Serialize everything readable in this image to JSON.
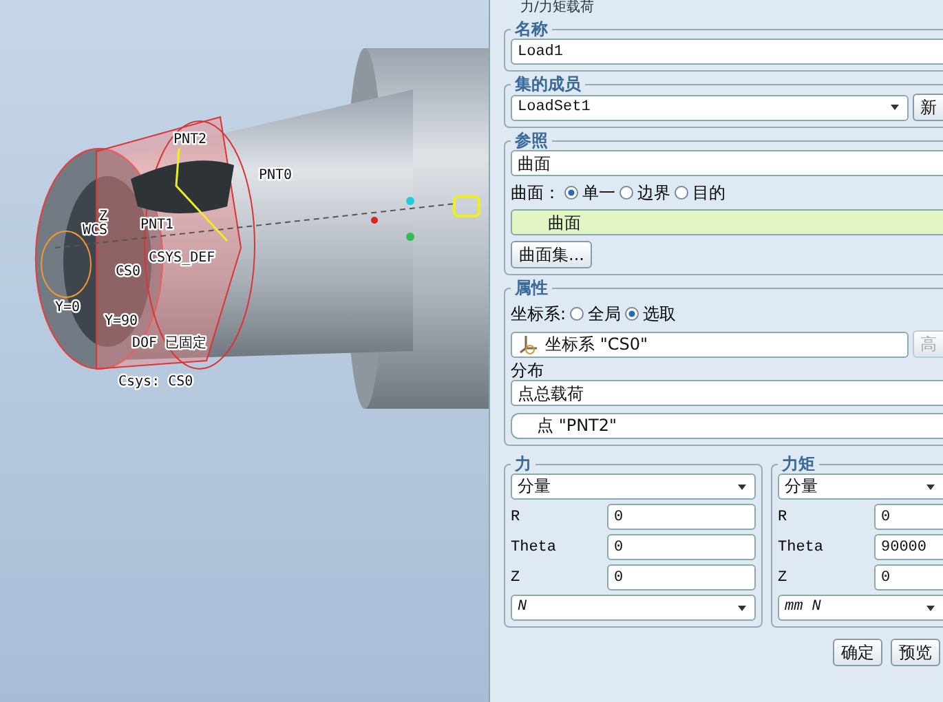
{
  "window": {
    "title": "力/力矩载荷"
  },
  "viewport": {
    "labels": [
      "PNT2",
      "PNT0",
      "PNT1",
      "Z",
      "WCS",
      "CSYS_DEF",
      "CS0",
      "Y=0",
      "Y=90",
      "DOF 已固定",
      "Csys: CS0"
    ]
  },
  "name": {
    "label": "名称",
    "value": "Load1"
  },
  "member_set": {
    "label": "集的成员",
    "value": "LoadSet1",
    "button": "新"
  },
  "references": {
    "label": "参照",
    "type_value": "曲面",
    "radio_label": "曲面：",
    "options": [
      {
        "label": "单一",
        "selected": true
      },
      {
        "label": "边界",
        "selected": false
      },
      {
        "label": "目的",
        "selected": false
      }
    ],
    "collector": "曲面",
    "button": "曲面集..."
  },
  "properties": {
    "label": "属性",
    "csys_label": "坐标系:",
    "options": [
      {
        "label": "全局",
        "selected": false
      },
      {
        "label": "选取",
        "selected": true
      }
    ],
    "csys_collector": "坐标系 \"CS0\"",
    "side_button": {
      "label": "高",
      "disabled": true
    },
    "distribution_label": "分布",
    "distribution_value": "点总载荷",
    "point_collector": "点 \"PNT2\""
  },
  "force": {
    "label": "力",
    "mode": "分量",
    "fields": [
      {
        "label": "R",
        "value": "0"
      },
      {
        "label": "Theta",
        "value": "0"
      },
      {
        "label": "Z",
        "value": "0"
      }
    ],
    "unit": "N"
  },
  "moment": {
    "label": "力矩",
    "mode": "分量",
    "fields": [
      {
        "label": "R",
        "value": "0"
      },
      {
        "label": "Theta",
        "value": "90000"
      },
      {
        "label": "Z",
        "value": "0"
      }
    ],
    "unit": "mm N"
  },
  "buttons": [
    "确定",
    "预览"
  ]
}
